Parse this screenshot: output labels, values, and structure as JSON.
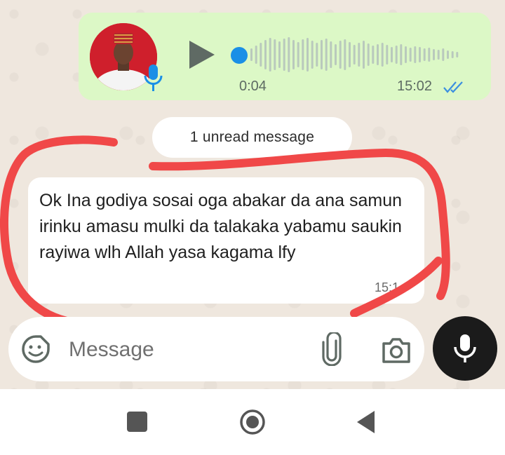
{
  "voice_note": {
    "duration": "0:04",
    "time": "15:02",
    "status": "read",
    "progress": 0.0
  },
  "unread_banner": {
    "label": "1 unread message"
  },
  "message": {
    "text": "Ok Ina godiya sosai oga abakar da ana samun irinku amasu mulki da talakaka yabamu saukin rayiwa wlh Allah yasa kagama lfy",
    "time": "15:1"
  },
  "composer": {
    "placeholder": "Message"
  },
  "icons": {
    "emoji": "sticker-emoji-icon",
    "attach": "paperclip-icon",
    "camera": "camera-icon",
    "mic": "microphone-icon",
    "play": "play-icon",
    "read_receipt": "double-check-icon"
  },
  "colors": {
    "outgoing_bubble": "#dcf8c6",
    "incoming_bubble": "#ffffff",
    "read_tick": "#3b8fe0",
    "scrub": "#1a8fe6",
    "annotation": "#f04848"
  }
}
